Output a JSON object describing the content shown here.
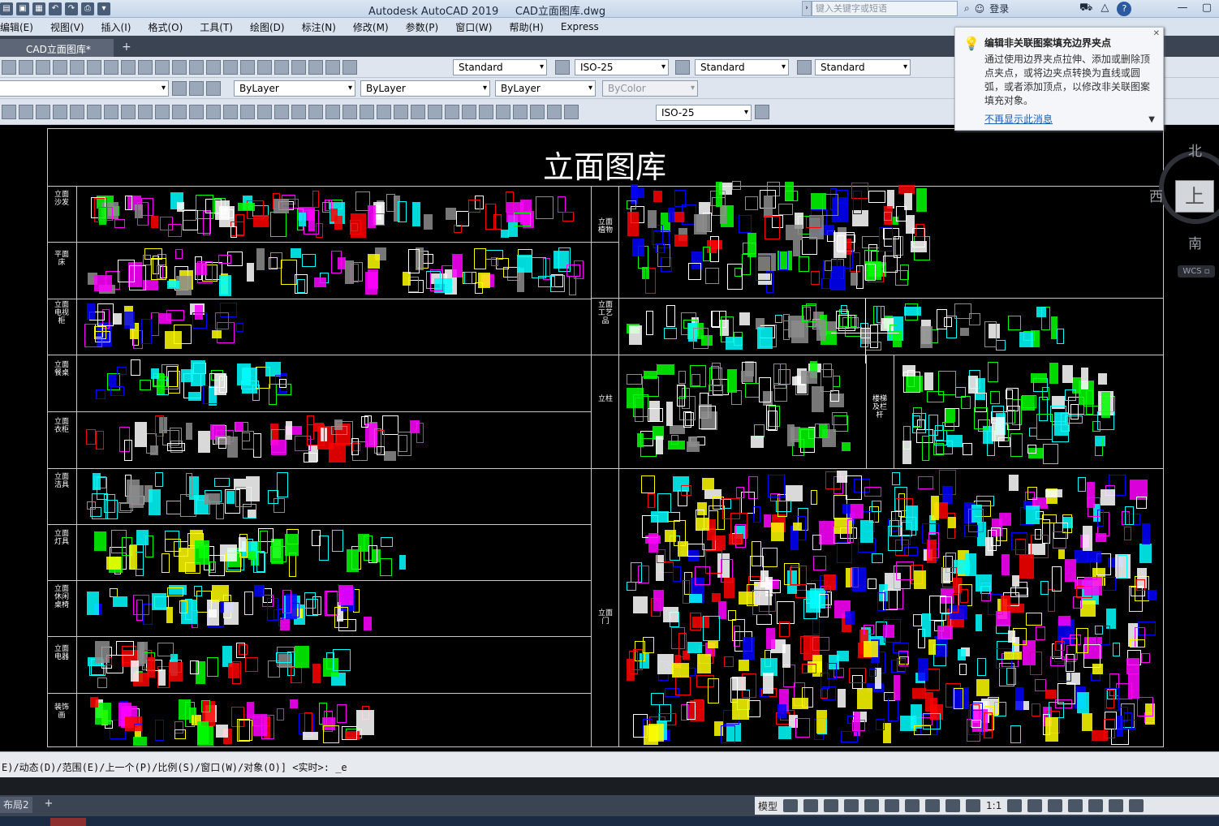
{
  "window": {
    "app_title": "Autodesk AutoCAD 2019",
    "file_title": "CAD立面图库.dwg",
    "search_placeholder": "键入关键字或短语",
    "login_label": "登录"
  },
  "menus": [
    "编辑(E)",
    "视图(V)",
    "插入(I)",
    "格式(O)",
    "工具(T)",
    "绘图(D)",
    "标注(N)",
    "修改(M)",
    "参数(P)",
    "窗口(W)",
    "帮助(H)",
    "Express"
  ],
  "doc_tab": {
    "label": "CAD立面图库*",
    "add": "+"
  },
  "toolbar_styles": {
    "text_style": "Standard",
    "dim_style": "ISO-25",
    "table_style": "Standard",
    "multileader_style": "Standard"
  },
  "properties": {
    "layer": "",
    "color": "ByLayer",
    "linetype": "ByLayer",
    "lineweight": "ByLayer",
    "plot_style": "ByColor",
    "dim_style_2": "ISO-25"
  },
  "drawing": {
    "title": "立面图库",
    "left_rows": [
      "立面沙发",
      "平面床",
      "立面电视柜",
      "立面餐桌",
      "立面衣柜",
      "立面洁具",
      "立面灯具",
      "立面休闲桌椅",
      "立面电器",
      "装饰画"
    ],
    "right_rows": [
      "立面植物",
      "立面工艺品",
      "立柱",
      "楼梯及栏杆",
      "立面门"
    ]
  },
  "viewcube": {
    "north": "北",
    "west": "西",
    "south": "南",
    "face": "上",
    "wcs": "WCS ▫"
  },
  "tooltip": {
    "title": "编辑非关联图案填充边界夹点",
    "body": "通过使用边界夹点拉伸、添加或删除顶点夹点，或将边夹点转换为直线或圆弧，或者添加顶点，以修改非关联图案填充对象。",
    "link": "不再显示此消息"
  },
  "command_line": "E)/动态(D)/范围(E)/上一个(P)/比例(S)/窗口(W)/对象(O)] <实时>: _e",
  "status": {
    "layout_tab": "布局2",
    "model": "模型",
    "scale": "1:1"
  },
  "colors": {
    "yellow": "#ffff00",
    "magenta": "#ff00ff",
    "cyan": "#00ffff",
    "red": "#ff0000",
    "blue": "#0000ff",
    "green": "#00ff00",
    "white": "#ffffff",
    "grey": "#8c8c8c"
  }
}
